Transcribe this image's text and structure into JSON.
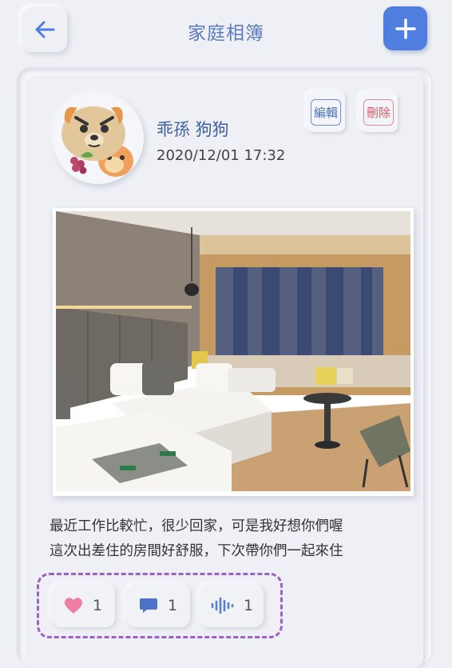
{
  "header": {
    "title": "家庭相簿",
    "back_icon": "arrow-left-icon",
    "add_icon": "plus-icon"
  },
  "post": {
    "user_name": "乖孫 狗狗",
    "timestamp": "2020/12/01 17:32",
    "edit_label": "編輯",
    "delete_label": "刪除",
    "caption": "最近工作比較忙，很少回家，可是我好想你們喔\n這次出差住的房間好舒服，下次帶你們一起來住"
  },
  "reactions": {
    "likes": "1",
    "comments": "1",
    "voice": "1"
  },
  "colors": {
    "accent": "#4f7ee0",
    "title": "#5a7bbf",
    "heart": "#ee7fa2",
    "comment": "#4c73c6",
    "voice": "#5b7fd0",
    "highlight_border": "#9a62c9"
  }
}
